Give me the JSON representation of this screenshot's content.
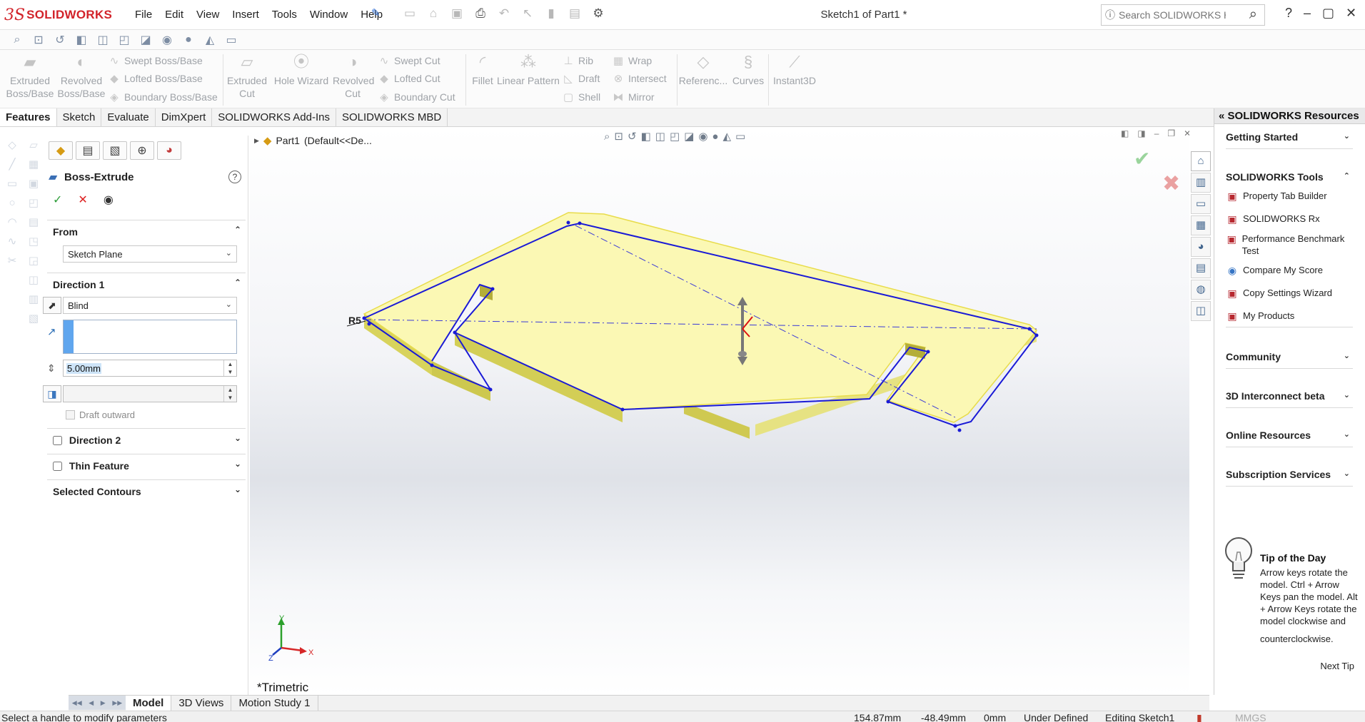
{
  "app": {
    "brand": "SOLIDWORKS",
    "document_title": "Sketch1 of Part1 *",
    "menu": [
      "File",
      "Edit",
      "View",
      "Insert",
      "Tools",
      "Window",
      "Help"
    ],
    "search_placeholder": "Search SOLIDWORKS Help"
  },
  "command_manager": {
    "extruded_boss": "Extruded Boss/Base",
    "revolved_boss": "Revolved Boss/Base",
    "swept_boss": "Swept Boss/Base",
    "lofted_boss": "Lofted Boss/Base",
    "boundary_boss": "Boundary Boss/Base",
    "extruded_cut": "Extruded Cut",
    "hole_wizard": "Hole Wizard",
    "revolved_cut": "Revolved Cut",
    "swept_cut": "Swept Cut",
    "lofted_cut": "Lofted Cut",
    "boundary_cut": "Boundary Cut",
    "fillet": "Fillet",
    "linear_pattern": "Linear Pattern",
    "rib": "Rib",
    "draft": "Draft",
    "shell": "Shell",
    "wrap": "Wrap",
    "intersect": "Intersect",
    "mirror": "Mirror",
    "reference": "Referenc...",
    "curves": "Curves",
    "instant3d": "Instant3D"
  },
  "tabs": [
    "Features",
    "Sketch",
    "Evaluate",
    "DimXpert",
    "SOLIDWORKS Add-Ins",
    "SOLIDWORKS MBD"
  ],
  "property_manager": {
    "title": "Boss-Extrude",
    "help": "?",
    "from": {
      "label": "From",
      "value": "Sketch Plane"
    },
    "direction1": {
      "label": "Direction 1",
      "end_condition": "Blind",
      "depth": "5.00mm",
      "draft_outward": "Draft outward"
    },
    "direction2": "Direction 2",
    "thin_feature": "Thin Feature",
    "selected_contours": "Selected Contours"
  },
  "graphics": {
    "tree_root": "Part1",
    "tree_config": "(Default<<De...",
    "dimension_label": "R5",
    "view_name": "*Trimetric",
    "triad_x": "X",
    "triad_y": "Y",
    "triad_z": "Z"
  },
  "task_pane": {
    "title": "SOLIDWORKS Resources",
    "getting_started": "Getting Started",
    "tools_title": "SOLIDWORKS Tools",
    "tools": [
      "Property Tab Builder",
      "SOLIDWORKS Rx",
      "Performance Benchmark Test",
      "Compare My Score",
      "Copy Settings Wizard",
      "My Products"
    ],
    "community": "Community",
    "interconnect": "3D Interconnect beta",
    "online_resources": "Online Resources",
    "subscription": "Subscription Services",
    "tip_title": "Tip of the Day",
    "tip_text": "Arrow keys rotate the model. Ctrl + Arrow Keys pan the model. Alt + Arrow Keys rotate the model clockwise and",
    "tip_text2": "counterclockwise.",
    "next_tip": "Next Tip"
  },
  "bottom_tabs": [
    "Model",
    "3D Views",
    "Motion Study 1"
  ],
  "status": {
    "message": "Select a handle to modify parameters",
    "x": "154.87mm",
    "y": "-48.49mm",
    "z": "0mm",
    "state": "Under Defined",
    "editing": "Editing Sketch1",
    "units": "MMGS"
  },
  "colors": {
    "brand_red": "#d2232a",
    "preview_fill": "#fbf8b4",
    "sketch_blue": "#1a1ad6",
    "selection_blue": "#60a6ee"
  }
}
